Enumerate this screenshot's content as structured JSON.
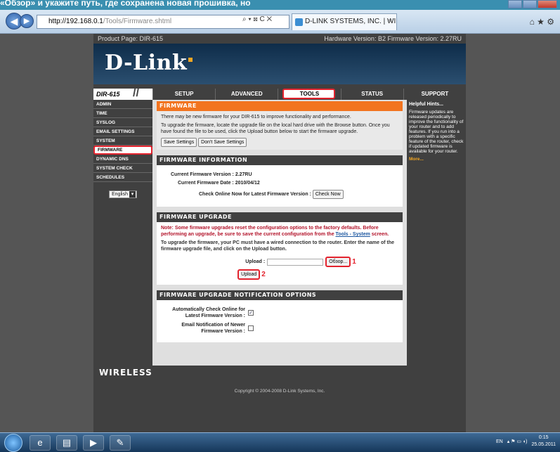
{
  "caption": "«Обзор» и укажите путь, где сохранена новая прошивка, но",
  "browser": {
    "address_host": "http://192.168.0.1",
    "address_path": "/Tools/Firmware.shtml",
    "tab_title": "D-LINK SYSTEMS, INC. | WI...",
    "tab_close": "×",
    "addr_icons": "⌕ ▾ ⊠ C ✕"
  },
  "dlink": {
    "product_page": "Product Page: DIR-615",
    "versions": "Hardware Version: B2   Firmware Version: 2.27RU",
    "logo": "D-Link",
    "model": "DIR-615",
    "tabs": [
      "SETUP",
      "ADVANCED",
      "TOOLS",
      "STATUS",
      "SUPPORT"
    ],
    "sidebar": [
      "ADMIN",
      "TIME",
      "SYSLOG",
      "EMAIL SETTINGS",
      "SYSTEM",
      "FIRMWARE",
      "DYNAMIC DNS",
      "SYSTEM CHECK",
      "SCHEDULES"
    ],
    "language": "English"
  },
  "firmware": {
    "title": "FIRMWARE",
    "p1": "There may be new firmware for your DIR-615 to improve functionality and performance.",
    "p2": "To upgrade the firmware, locate the upgrade file on the local hard drive with the Browse button. Once you have found the file to be used, click the Upload button below to start the firmware upgrade.",
    "save": "Save Settings",
    "dont_save": "Don't Save Settings"
  },
  "info": {
    "title": "FIRMWARE INFORMATION",
    "current_version_label": "Current Firmware Version :",
    "current_version": "2.27RU",
    "current_date_label": "Current Firmware Date :",
    "current_date": "2010/04/12",
    "check_label": "Check Online Now for Latest Firmware Version :",
    "check_btn": "Check Now"
  },
  "upgrade": {
    "title": "FIRMWARE UPGRADE",
    "note_before": "Note: Some firmware upgrades reset the configuration options to the factory defaults. Before performing an upgrade, be sure to save the current configuration from the",
    "note_link": "Tools - System",
    "note_after": "screen.",
    "instructions": "To upgrade the firmware, your PC must have a wired connection to the router. Enter the name of the firmware upgrade file, and click on the Upload button.",
    "upload_label": "Upload :",
    "browse_btn": "Обзор...",
    "num1": "1",
    "upload_btn": "Upload",
    "num2": "2"
  },
  "notify": {
    "title": "FIRMWARE UPGRADE NOTIFICATION OPTIONS",
    "auto_label": "Automatically Check Online for Latest Firmware Version :",
    "email_label": "Email Notification of Newer Firmware Version :",
    "check_mark": "✓"
  },
  "hints": {
    "title": "Helpful Hints...",
    "text": "Firmware updates are released periodically to improve the functionality of your router and to add features. If you run into a problem with a specific feature of the router, check if updated firmware is available for your router.",
    "more": "More..."
  },
  "footer": {
    "wireless": "WIRELESS",
    "copyright": "Copyright © 2004-2008 D-Link Systems, Inc."
  },
  "taskbar": {
    "lang": "EN",
    "time": "0:15",
    "date": "25.05.2011",
    "tray_icons": "▴ ⚑ ▭ ◖)",
    "app_icons": [
      "e",
      "▤",
      "▶",
      "✎"
    ]
  }
}
